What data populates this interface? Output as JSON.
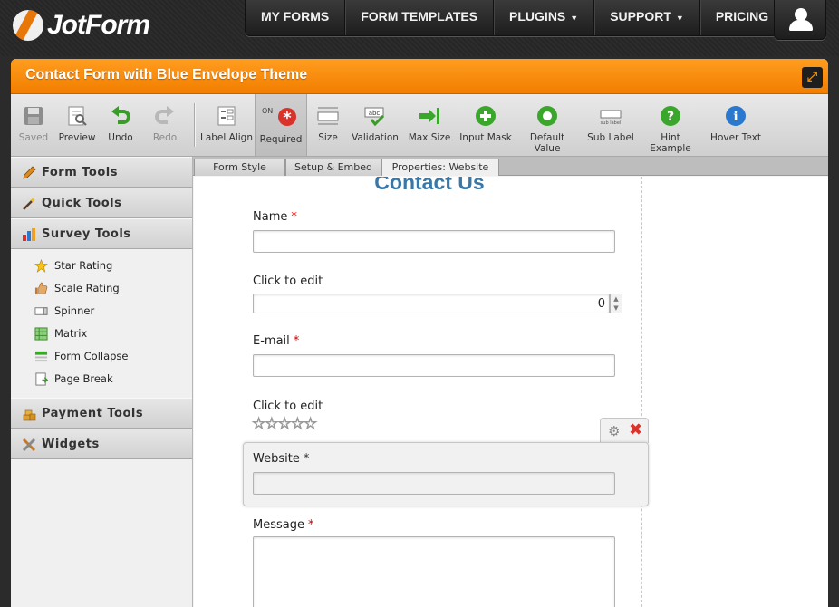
{
  "brand": {
    "logo_text": "JotForm"
  },
  "nav": {
    "items": [
      {
        "label": "MY FORMS",
        "dropdown": false
      },
      {
        "label": "FORM TEMPLATES",
        "dropdown": false
      },
      {
        "label": "PLUGINS",
        "dropdown": true
      },
      {
        "label": "SUPPORT",
        "dropdown": true
      },
      {
        "label": "PRICING",
        "dropdown": false
      }
    ],
    "caret": "▼",
    "user_icon": "user-icon"
  },
  "window": {
    "title": "Contact Form with Blue Envelope Theme",
    "fullscreen_icon": "fullscreen-icon"
  },
  "toolbar": {
    "save": "Saved",
    "preview": "Preview",
    "undo": "Undo",
    "redo": "Redo",
    "label_align": "Label Align",
    "required_state": "ON",
    "required": "Required",
    "size": "Size",
    "validation": "Validation",
    "validation_icon_text": "abc",
    "max_size": "Max Size",
    "input_mask": "Input Mask",
    "default_value": "Default Value",
    "sub_label": "Sub Label",
    "sub_label_icon_text": "sub label",
    "hint_example": "Hint Example",
    "hover_text": "Hover Text"
  },
  "sidebar": {
    "sections": {
      "form_tools": "Form Tools",
      "quick_tools": "Quick Tools",
      "survey_tools": "Survey Tools",
      "payment_tools": "Payment Tools",
      "widgets": "Widgets"
    },
    "survey_items": [
      "Star Rating",
      "Scale Rating",
      "Spinner",
      "Matrix",
      "Form Collapse",
      "Page Break"
    ]
  },
  "tabs": {
    "form_style": "Form Style",
    "setup_embed": "Setup & Embed",
    "properties": "Properties: Website"
  },
  "form": {
    "title": "Contact Us",
    "required_marker": "*",
    "fields": {
      "name": "Name",
      "spinner_label": "Click to edit",
      "spinner_value": "0",
      "email": "E-mail",
      "rating_label": "Click to edit",
      "rating_stars": "☆☆☆☆☆",
      "website": "Website",
      "message": "Message"
    }
  },
  "colors": {
    "accent_orange": "#f28a00",
    "form_title_blue": "#3977a7",
    "required_red": "#cc0000"
  }
}
